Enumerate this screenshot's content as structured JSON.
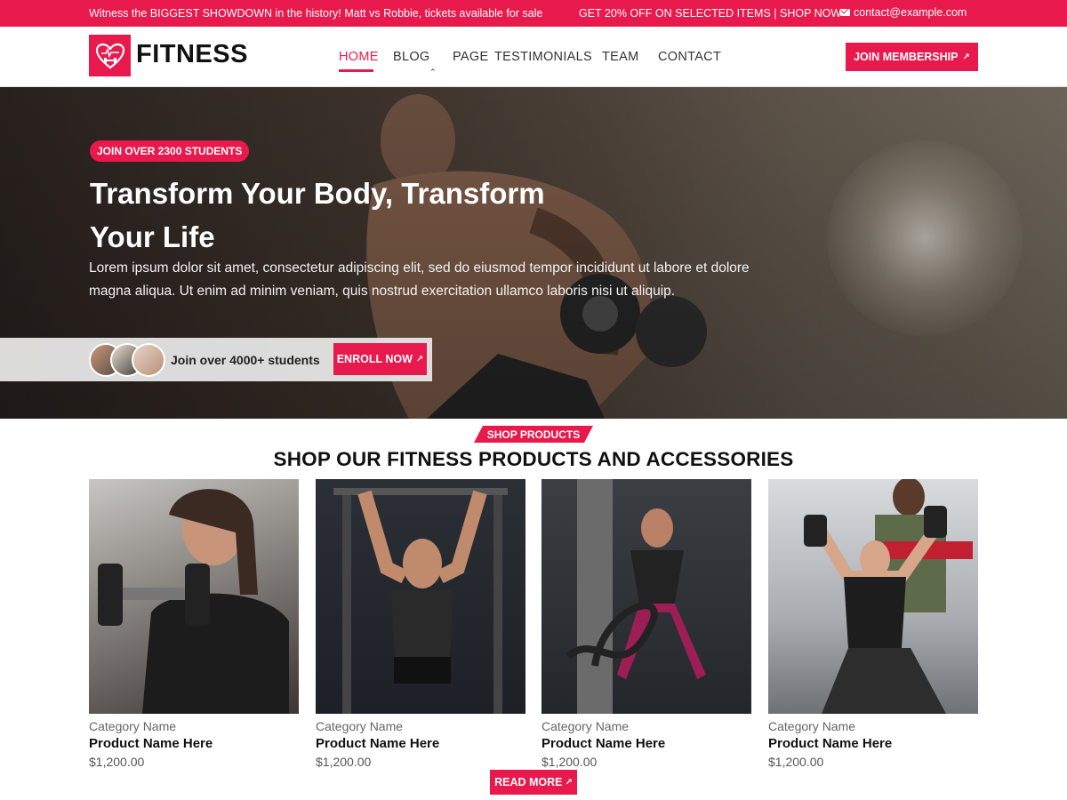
{
  "topbar": {
    "promo": "Witness the BIGGEST SHOWDOWN in the history! Matt vs Robbie, tickets available for sale",
    "offer": "GET 20% OFF ON SELECTED ITEMS | SHOP NOW",
    "email": "contact@example.com",
    "email_icon": "mail-icon"
  },
  "header": {
    "logo_text": "FITNESS",
    "logo_icon": "heart-dumbbell-icon",
    "nav": [
      {
        "label": "HOME",
        "active": true
      },
      {
        "label": "BLOG",
        "has_dropdown": true
      },
      {
        "label": "PAGE"
      },
      {
        "label": "TESTIMONIALS"
      },
      {
        "label": "TEAM"
      },
      {
        "label": "CONTACT"
      }
    ],
    "cta_label": "JOIN MEMBERSHIP",
    "cta_icon": "arrow-up-right-icon"
  },
  "hero": {
    "badge": "JOIN OVER 2300 STUDENTS",
    "title": "Transform Your Body, Transform Your Life",
    "text": "Lorem ipsum dolor sit amet, consectetur adipiscing elit, sed do eiusmod tempor incididunt ut labore et dolore magna aliqua. Ut enim ad minim veniam, quis nostrud exercitation ullamco laboris nisi ut aliquip.",
    "strip_text": "Join over 4000+ students",
    "enroll_label": "ENROLL NOW"
  },
  "shop": {
    "tag": "SHOP PRODUCTS",
    "title": "SHOP OUR FITNESS PRODUCTS AND ACCESSORIES",
    "products": [
      {
        "category": "Category Name",
        "name": "Product Name Here",
        "price": "$1,200.00"
      },
      {
        "category": "Category Name",
        "name": "Product Name Here",
        "price": "$1,200.00"
      },
      {
        "category": "Category Name",
        "name": "Product Name Here",
        "price": "$1,200.00"
      },
      {
        "category": "Category Name",
        "name": "Product Name Here",
        "price": "$1,200.00"
      }
    ],
    "read_more": "READ MORE"
  },
  "colors": {
    "accent": "#e8194d",
    "text_dark": "#111111",
    "muted": "#666666"
  }
}
